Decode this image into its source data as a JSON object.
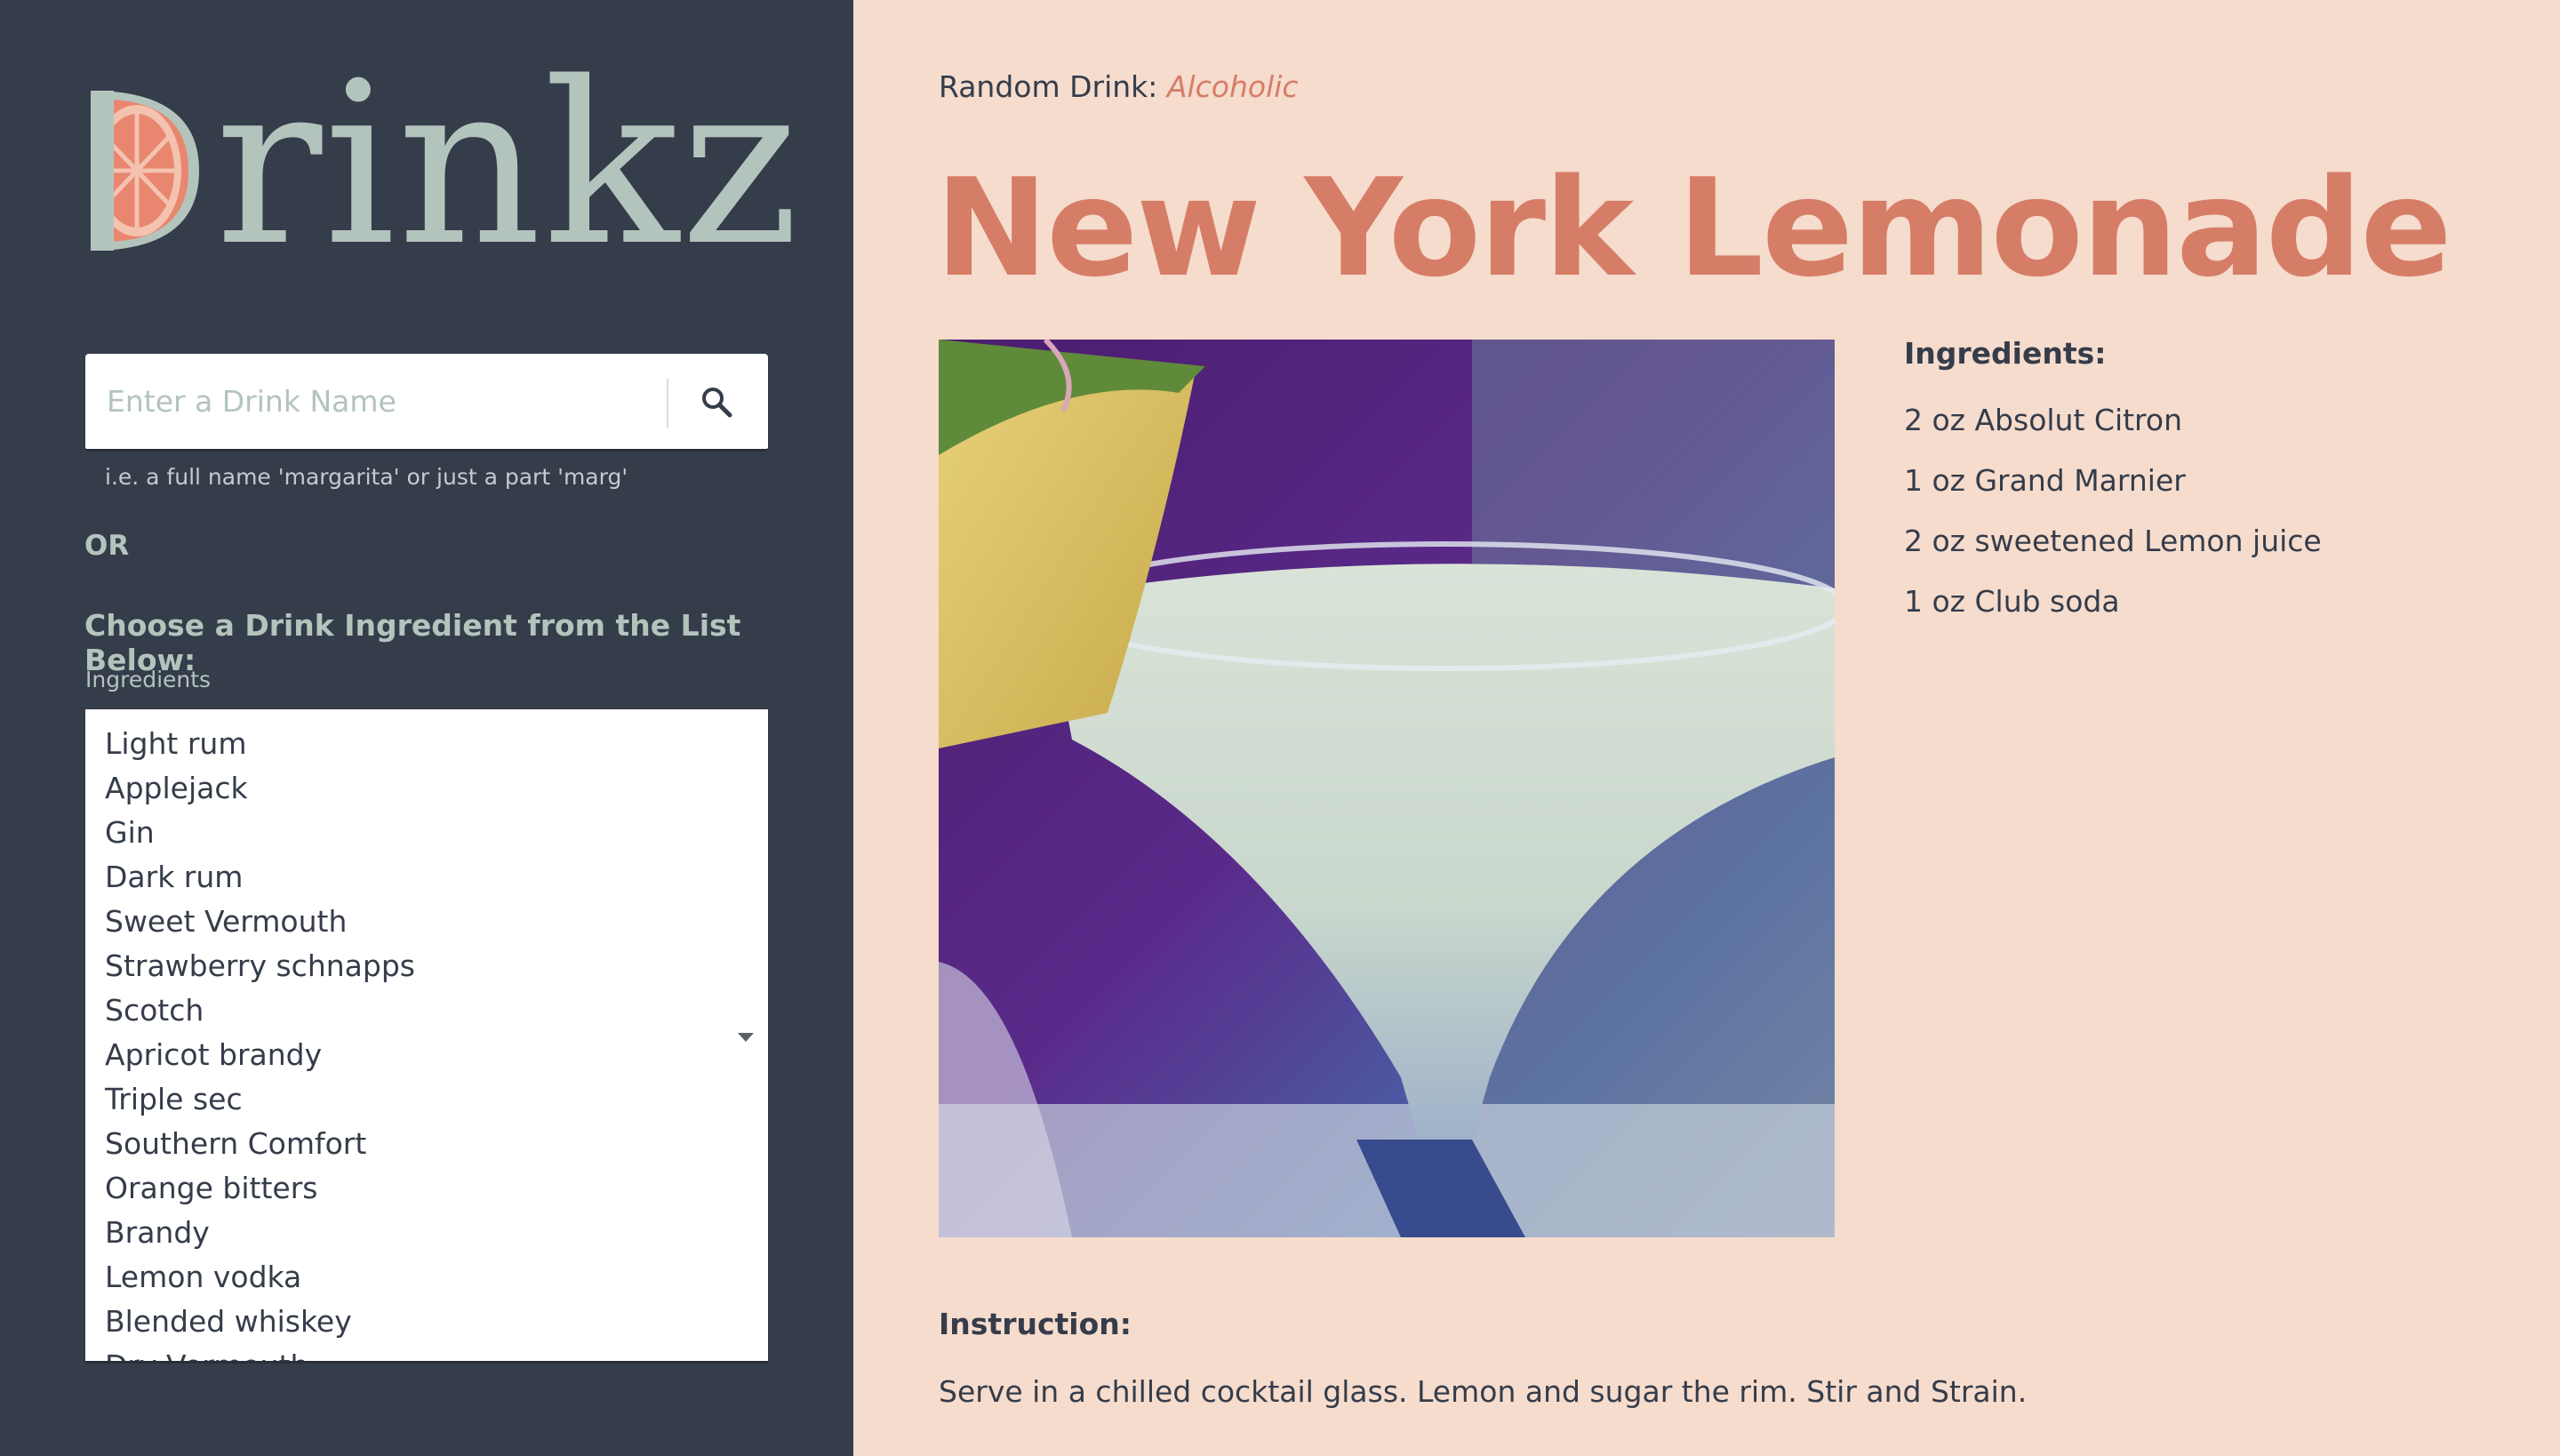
{
  "brand": {
    "logo_text": "rinkz",
    "logo_alt": "Drinkz"
  },
  "search": {
    "placeholder": "Enter a Drink Name",
    "value": "",
    "hint": "i.e. a full name 'margarita' or just a part 'marg'",
    "icon": "search-icon"
  },
  "sidebar": {
    "or_label": "OR",
    "choose_label": "Choose a Drink Ingredient from the List Below:",
    "ingredients_caption": "Ingredients",
    "ingredients": [
      "Light rum",
      "Applejack",
      "Gin",
      "Dark rum",
      "Sweet Vermouth",
      "Strawberry schnapps",
      "Scotch",
      "Apricot brandy",
      "Triple sec",
      "Southern Comfort",
      "Orange bitters",
      "Brandy",
      "Lemon vodka",
      "Blended whiskey",
      "Dry Vermouth"
    ]
  },
  "drink": {
    "random_label": "Random Drink:",
    "type": "Alcoholic",
    "name": "New York Lemonade",
    "ingredients_heading": "Ingredients:",
    "ingredients": [
      "2 oz Absolut Citron",
      "1 oz Grand Marnier",
      "2 oz sweetened Lemon juice",
      "1 oz Club soda"
    ],
    "instruction_heading": "Instruction:",
    "instruction": "Serve in a chilled cocktail glass. Lemon and sugar the rim. Stir and Strain."
  },
  "colors": {
    "sidebar_bg": "#353c4a",
    "main_bg": "#f5dccd",
    "accent": "#d67d68",
    "sage": "#b3c4bd",
    "text": "#353c4a"
  }
}
